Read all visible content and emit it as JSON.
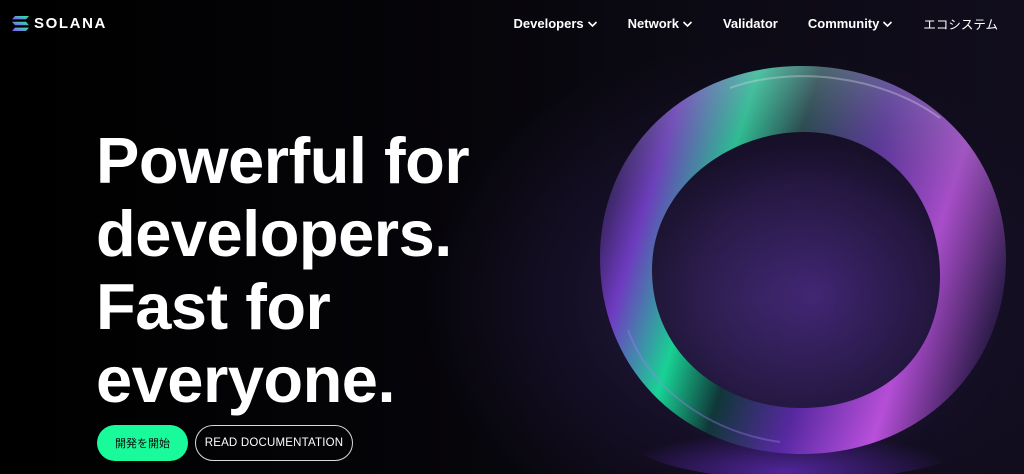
{
  "brand": {
    "name": "SOLANA",
    "logo_icon": "solana-logo-icon",
    "colors": [
      "#19fb9b",
      "#9945ff"
    ]
  },
  "nav": {
    "items": [
      {
        "label": "Developers",
        "has_dropdown": true
      },
      {
        "label": "Network",
        "has_dropdown": true
      },
      {
        "label": "Validator",
        "has_dropdown": false
      },
      {
        "label": "Community",
        "has_dropdown": true
      },
      {
        "label": "エコシステム",
        "has_dropdown": false
      }
    ]
  },
  "hero": {
    "title_lines": [
      "Powerful for",
      "developers.",
      "Fast for",
      "everyone."
    ],
    "primary_cta": "開発を開始",
    "secondary_cta": "READ DOCUMENTATION"
  },
  "colors": {
    "accent_green": "#19fb9b",
    "accent_purple": "#9945ff",
    "background": "#000000"
  }
}
